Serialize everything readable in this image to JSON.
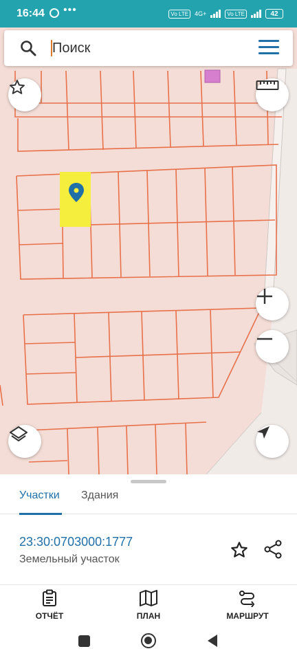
{
  "status_bar": {
    "time": "16:44",
    "more_indicator": "•••",
    "volte1": "Vo LTE",
    "network": "4G+",
    "volte2": "Vo LTE",
    "battery": "42"
  },
  "search": {
    "placeholder": "Поиск",
    "value": ""
  },
  "sheet": {
    "tabs": [
      {
        "label": "Участки",
        "active": true
      },
      {
        "label": "Здания",
        "active": false
      }
    ],
    "cadastral_number": "23:30:0703000:1777",
    "object_type": "Земельный участок"
  },
  "bottom_nav": [
    {
      "label": "ОТЧЁТ",
      "icon": "clipboard-icon"
    },
    {
      "label": "ПЛАН",
      "icon": "map-icon"
    },
    {
      "label": "МАРШРУТ",
      "icon": "route-icon"
    }
  ],
  "colors": {
    "status_bar": "#23a3ae",
    "accent": "#1f6fa8",
    "parcel_line": "#e8704a",
    "map_background": "#f4ddd6",
    "selected_parcel": "#f5ee3c"
  }
}
